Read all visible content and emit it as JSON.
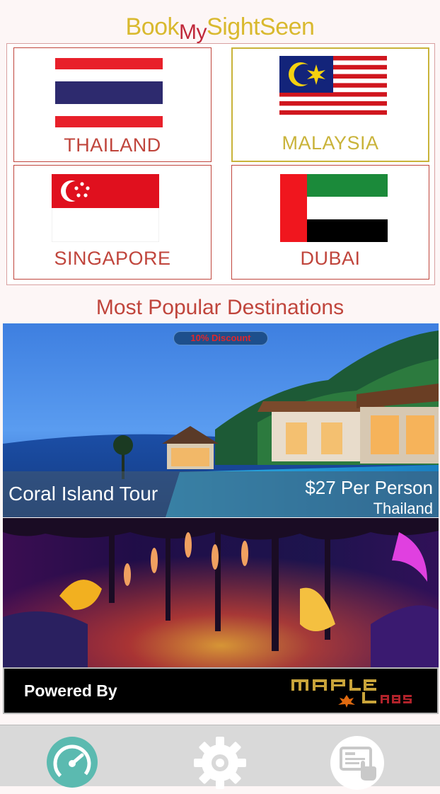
{
  "app": {
    "title_part1": "Book",
    "title_part2": "My",
    "title_part3": "SightSeen"
  },
  "countries": [
    {
      "name": "THAILAND",
      "selected": false
    },
    {
      "name": "MALAYSIA",
      "selected": true
    },
    {
      "name": "SINGAPORE",
      "selected": false
    },
    {
      "name": "DUBAI",
      "selected": false
    }
  ],
  "popular": {
    "heading": "Most Popular Destinations",
    "featured": {
      "badge": "10% Discount",
      "name": "Coral Island Tour",
      "price": "$27 Per  Person",
      "country": "Thailand"
    }
  },
  "footer": {
    "powered_by": "Powered By",
    "logo_text": "MAPLE LABS"
  },
  "tabbar": {
    "icons": [
      "dashboard-gauge-icon",
      "gear-icon",
      "touch-card-icon"
    ]
  },
  "colors": {
    "accent_gold": "#d9b92f",
    "accent_red": "#c0453c",
    "tabbar_bg": "#d9d9d9"
  }
}
